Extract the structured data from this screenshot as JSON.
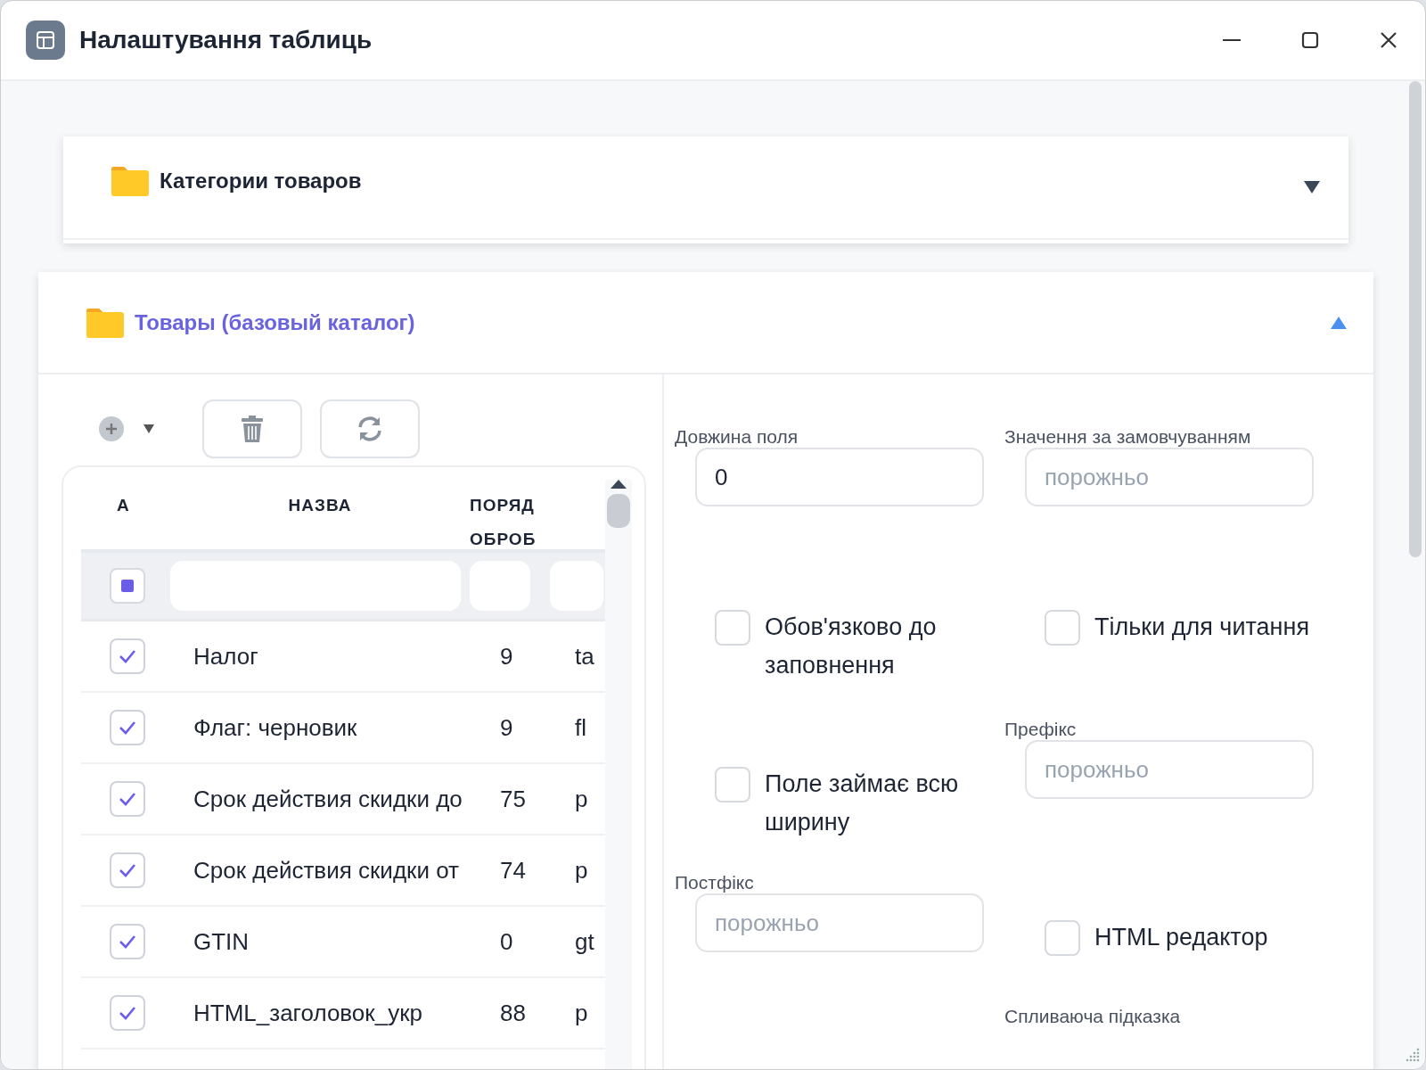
{
  "window": {
    "title": "Налаштування таблиць"
  },
  "sections": [
    {
      "title": "Категории товаров",
      "expanded": false
    },
    {
      "title": "Товары (базовый каталог)",
      "expanded": true
    }
  ],
  "table": {
    "columns": [
      {
        "lines": [
          "А"
        ]
      },
      {
        "lines": [
          "НАЗВА"
        ]
      },
      {
        "lines": [
          "ПОРЯД",
          "ОБРОБ"
        ]
      }
    ],
    "select_all": {
      "indeterminate": true
    },
    "rows": [
      {
        "checked": true,
        "name": "Налог",
        "order": "9",
        "column_4": "ta"
      },
      {
        "checked": true,
        "name": "Флаг: черновик",
        "order": "9",
        "column_4": "fl"
      },
      {
        "checked": true,
        "name": "Срок действия скидки до",
        "order": "75",
        "column_4": "p"
      },
      {
        "checked": true,
        "name": "Срок действия скидки от",
        "order": "74",
        "column_4": "p"
      },
      {
        "checked": true,
        "name": "GTIN",
        "order": "0",
        "column_4": "gt"
      },
      {
        "checked": true,
        "name": "HTML_заголовок_укр",
        "order": "88",
        "column_4": "p"
      }
    ]
  },
  "form": [
    {
      "kind": "input",
      "label": "Довжина поля",
      "value": "0"
    },
    {
      "kind": "input",
      "label": "Значення за замовчуванням",
      "placeholder": "порожньо"
    },
    {
      "kind": "checkbox",
      "label": "Обов'язково до заповнення",
      "checked": false
    },
    {
      "kind": "checkbox",
      "label": "Тільки для читання",
      "checked": false
    },
    {
      "kind": "checkbox",
      "label": "Поле займає всю ширину",
      "checked": false
    },
    {
      "kind": "input",
      "label": "Префікс",
      "placeholder": "порожньо"
    },
    {
      "kind": "input",
      "label": "Постфікс",
      "placeholder": "порожньо"
    },
    {
      "kind": "checkbox",
      "label": "HTML редактор",
      "checked": false
    },
    {
      "kind": "label",
      "label": "Спливаюча підказка"
    }
  ]
}
